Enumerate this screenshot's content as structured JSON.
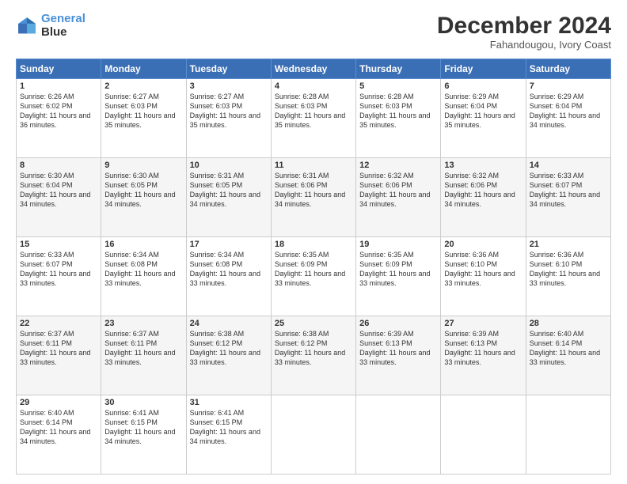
{
  "logo": {
    "line1": "General",
    "line2": "Blue"
  },
  "title": "December 2024",
  "subtitle": "Fahandougou, Ivory Coast",
  "header_days": [
    "Sunday",
    "Monday",
    "Tuesday",
    "Wednesday",
    "Thursday",
    "Friday",
    "Saturday"
  ],
  "weeks": [
    [
      {
        "day": "1",
        "sunrise": "6:26 AM",
        "sunset": "6:02 PM",
        "daylight": "11 hours and 36 minutes."
      },
      {
        "day": "2",
        "sunrise": "6:27 AM",
        "sunset": "6:03 PM",
        "daylight": "11 hours and 35 minutes."
      },
      {
        "day": "3",
        "sunrise": "6:27 AM",
        "sunset": "6:03 PM",
        "daylight": "11 hours and 35 minutes."
      },
      {
        "day": "4",
        "sunrise": "6:28 AM",
        "sunset": "6:03 PM",
        "daylight": "11 hours and 35 minutes."
      },
      {
        "day": "5",
        "sunrise": "6:28 AM",
        "sunset": "6:03 PM",
        "daylight": "11 hours and 35 minutes."
      },
      {
        "day": "6",
        "sunrise": "6:29 AM",
        "sunset": "6:04 PM",
        "daylight": "11 hours and 35 minutes."
      },
      {
        "day": "7",
        "sunrise": "6:29 AM",
        "sunset": "6:04 PM",
        "daylight": "11 hours and 34 minutes."
      }
    ],
    [
      {
        "day": "8",
        "sunrise": "6:30 AM",
        "sunset": "6:04 PM",
        "daylight": "11 hours and 34 minutes."
      },
      {
        "day": "9",
        "sunrise": "6:30 AM",
        "sunset": "6:05 PM",
        "daylight": "11 hours and 34 minutes."
      },
      {
        "day": "10",
        "sunrise": "6:31 AM",
        "sunset": "6:05 PM",
        "daylight": "11 hours and 34 minutes."
      },
      {
        "day": "11",
        "sunrise": "6:31 AM",
        "sunset": "6:06 PM",
        "daylight": "11 hours and 34 minutes."
      },
      {
        "day": "12",
        "sunrise": "6:32 AM",
        "sunset": "6:06 PM",
        "daylight": "11 hours and 34 minutes."
      },
      {
        "day": "13",
        "sunrise": "6:32 AM",
        "sunset": "6:06 PM",
        "daylight": "11 hours and 34 minutes."
      },
      {
        "day": "14",
        "sunrise": "6:33 AM",
        "sunset": "6:07 PM",
        "daylight": "11 hours and 34 minutes."
      }
    ],
    [
      {
        "day": "15",
        "sunrise": "6:33 AM",
        "sunset": "6:07 PM",
        "daylight": "11 hours and 33 minutes."
      },
      {
        "day": "16",
        "sunrise": "6:34 AM",
        "sunset": "6:08 PM",
        "daylight": "11 hours and 33 minutes."
      },
      {
        "day": "17",
        "sunrise": "6:34 AM",
        "sunset": "6:08 PM",
        "daylight": "11 hours and 33 minutes."
      },
      {
        "day": "18",
        "sunrise": "6:35 AM",
        "sunset": "6:09 PM",
        "daylight": "11 hours and 33 minutes."
      },
      {
        "day": "19",
        "sunrise": "6:35 AM",
        "sunset": "6:09 PM",
        "daylight": "11 hours and 33 minutes."
      },
      {
        "day": "20",
        "sunrise": "6:36 AM",
        "sunset": "6:10 PM",
        "daylight": "11 hours and 33 minutes."
      },
      {
        "day": "21",
        "sunrise": "6:36 AM",
        "sunset": "6:10 PM",
        "daylight": "11 hours and 33 minutes."
      }
    ],
    [
      {
        "day": "22",
        "sunrise": "6:37 AM",
        "sunset": "6:11 PM",
        "daylight": "11 hours and 33 minutes."
      },
      {
        "day": "23",
        "sunrise": "6:37 AM",
        "sunset": "6:11 PM",
        "daylight": "11 hours and 33 minutes."
      },
      {
        "day": "24",
        "sunrise": "6:38 AM",
        "sunset": "6:12 PM",
        "daylight": "11 hours and 33 minutes."
      },
      {
        "day": "25",
        "sunrise": "6:38 AM",
        "sunset": "6:12 PM",
        "daylight": "11 hours and 33 minutes."
      },
      {
        "day": "26",
        "sunrise": "6:39 AM",
        "sunset": "6:13 PM",
        "daylight": "11 hours and 33 minutes."
      },
      {
        "day": "27",
        "sunrise": "6:39 AM",
        "sunset": "6:13 PM",
        "daylight": "11 hours and 33 minutes."
      },
      {
        "day": "28",
        "sunrise": "6:40 AM",
        "sunset": "6:14 PM",
        "daylight": "11 hours and 33 minutes."
      }
    ],
    [
      {
        "day": "29",
        "sunrise": "6:40 AM",
        "sunset": "6:14 PM",
        "daylight": "11 hours and 34 minutes."
      },
      {
        "day": "30",
        "sunrise": "6:41 AM",
        "sunset": "6:15 PM",
        "daylight": "11 hours and 34 minutes."
      },
      {
        "day": "31",
        "sunrise": "6:41 AM",
        "sunset": "6:15 PM",
        "daylight": "11 hours and 34 minutes."
      },
      null,
      null,
      null,
      null
    ]
  ]
}
